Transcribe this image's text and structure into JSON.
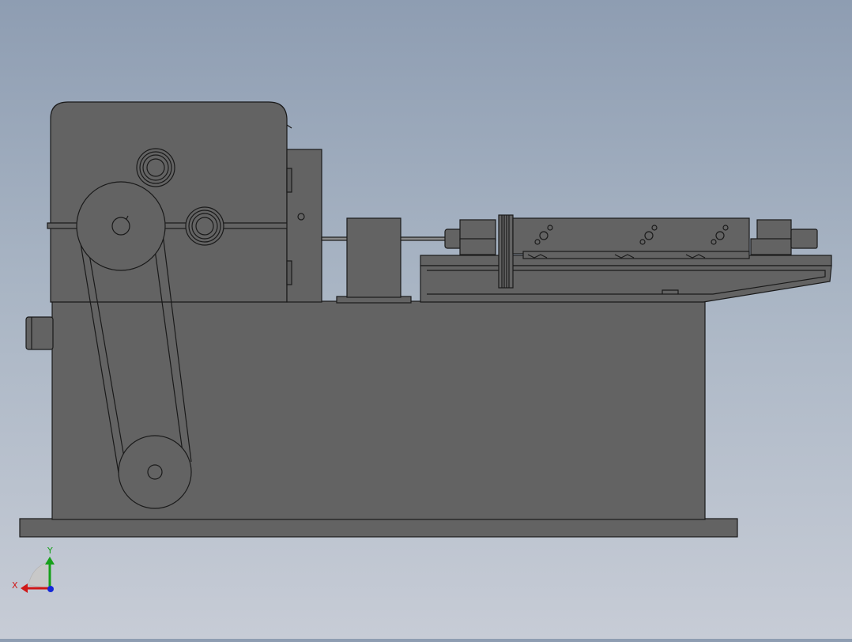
{
  "viewport": {
    "background_top": "#8e9db2",
    "background_bottom": "#c7ccd6",
    "part_color": "#636363",
    "edge_color": "#1a1a1a"
  },
  "model": {
    "view": "front",
    "parts": [
      "base-plate",
      "machine-body",
      "gearbox-housing",
      "motor-hub",
      "upper-pulley",
      "lower-pulley",
      "drive-belt",
      "bearing-upper",
      "bearing-middle",
      "side-bracket",
      "center-support-block",
      "drive-shaft",
      "rail-table",
      "carriage",
      "left-end-block",
      "right-end-block",
      "grooved-pulley",
      "spindle-end"
    ]
  },
  "triad": {
    "x_label": "X",
    "y_label": "Y",
    "x_color": "#d01818",
    "y_color": "#16a01a",
    "z_color": "#1428d8"
  }
}
